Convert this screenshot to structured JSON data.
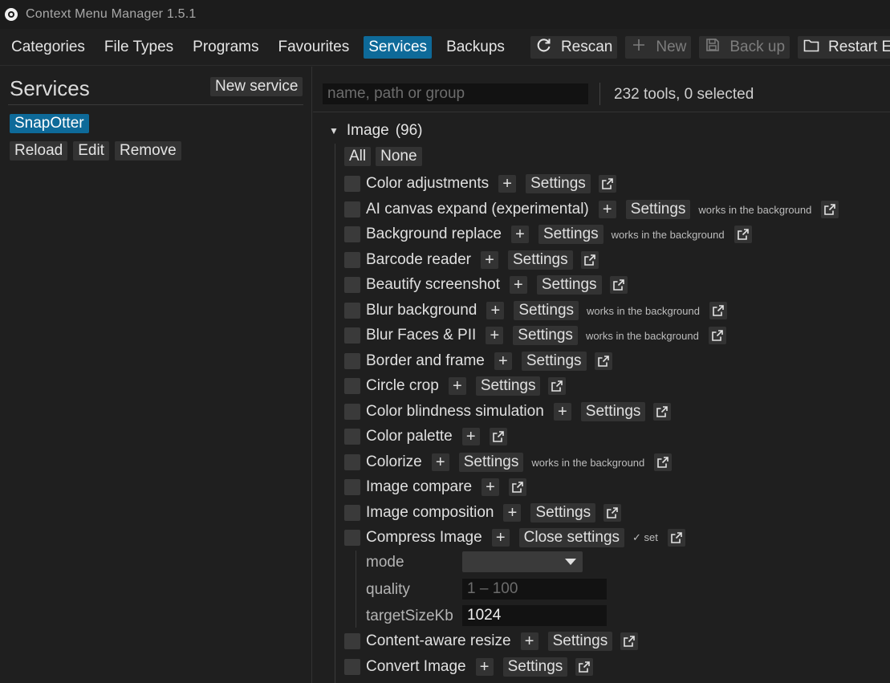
{
  "window": {
    "title": "Context Menu Manager 1.5.1"
  },
  "menu": {
    "tabs": [
      "Categories",
      "File Types",
      "Programs",
      "Favourites",
      "Services",
      "Backups"
    ],
    "active_tab": "Services",
    "actions": [
      {
        "label": "Rescan",
        "icon": "refresh-icon",
        "enabled": true
      },
      {
        "label": "New",
        "icon": "plus-icon",
        "enabled": false
      },
      {
        "label": "Back up",
        "icon": "save-icon",
        "enabled": false
      },
      {
        "label": "Restart Exp",
        "icon": "folder-icon",
        "enabled": true
      }
    ]
  },
  "left": {
    "title": "Services",
    "new_service_label": "New service",
    "selected_service": "SnapOtter",
    "actions": [
      "Reload",
      "Edit",
      "Remove"
    ]
  },
  "right": {
    "search_placeholder": "name, path or group",
    "count_text": "232 tools, 0 selected",
    "group": {
      "name": "Image",
      "count": "(96)"
    },
    "all_label": "All",
    "none_label": "None",
    "plus_symbol": "+",
    "settings_label": "Settings",
    "tools": [
      {
        "name": "Color adjustments",
        "settings": "Settings",
        "note": ""
      },
      {
        "name": "AI canvas expand (experimental)",
        "settings": "Settings",
        "note": "works in the background"
      },
      {
        "name": "Background replace",
        "settings": "Settings",
        "note": "works in the background"
      },
      {
        "name": "Barcode reader",
        "settings": "Settings",
        "note": ""
      },
      {
        "name": "Beautify screenshot",
        "settings": "Settings",
        "note": ""
      },
      {
        "name": "Blur background",
        "settings": "Settings",
        "note": "works in the background"
      },
      {
        "name": "Blur Faces & PII",
        "settings": "Settings",
        "note": "works in the background"
      },
      {
        "name": "Border and frame",
        "settings": "Settings",
        "note": ""
      },
      {
        "name": "Circle crop",
        "settings": "Settings",
        "note": ""
      },
      {
        "name": "Color blindness simulation",
        "settings": "Settings",
        "note": ""
      },
      {
        "name": "Color palette",
        "settings": "",
        "note": ""
      },
      {
        "name": "Colorize",
        "settings": "Settings",
        "note": "works in the background"
      },
      {
        "name": "Image compare",
        "settings": "",
        "note": ""
      },
      {
        "name": "Image composition",
        "settings": "Settings",
        "note": ""
      },
      {
        "name": "Compress Image",
        "settings": "Close settings",
        "note": "✓ set"
      }
    ],
    "compress_settings": {
      "mode_label": "mode",
      "mode_value": "",
      "quality_label": "quality",
      "quality_placeholder": "1 – 100",
      "target_label": "targetSizeKb",
      "target_value": "1024"
    },
    "tools_after": [
      {
        "name": "Content-aware resize",
        "settings": "Settings",
        "note": ""
      },
      {
        "name": "Convert Image",
        "settings": "Settings",
        "note": ""
      }
    ]
  },
  "colors": {
    "accent": "#0e6a99",
    "background": "#1f1f1f",
    "button": "#333333"
  }
}
